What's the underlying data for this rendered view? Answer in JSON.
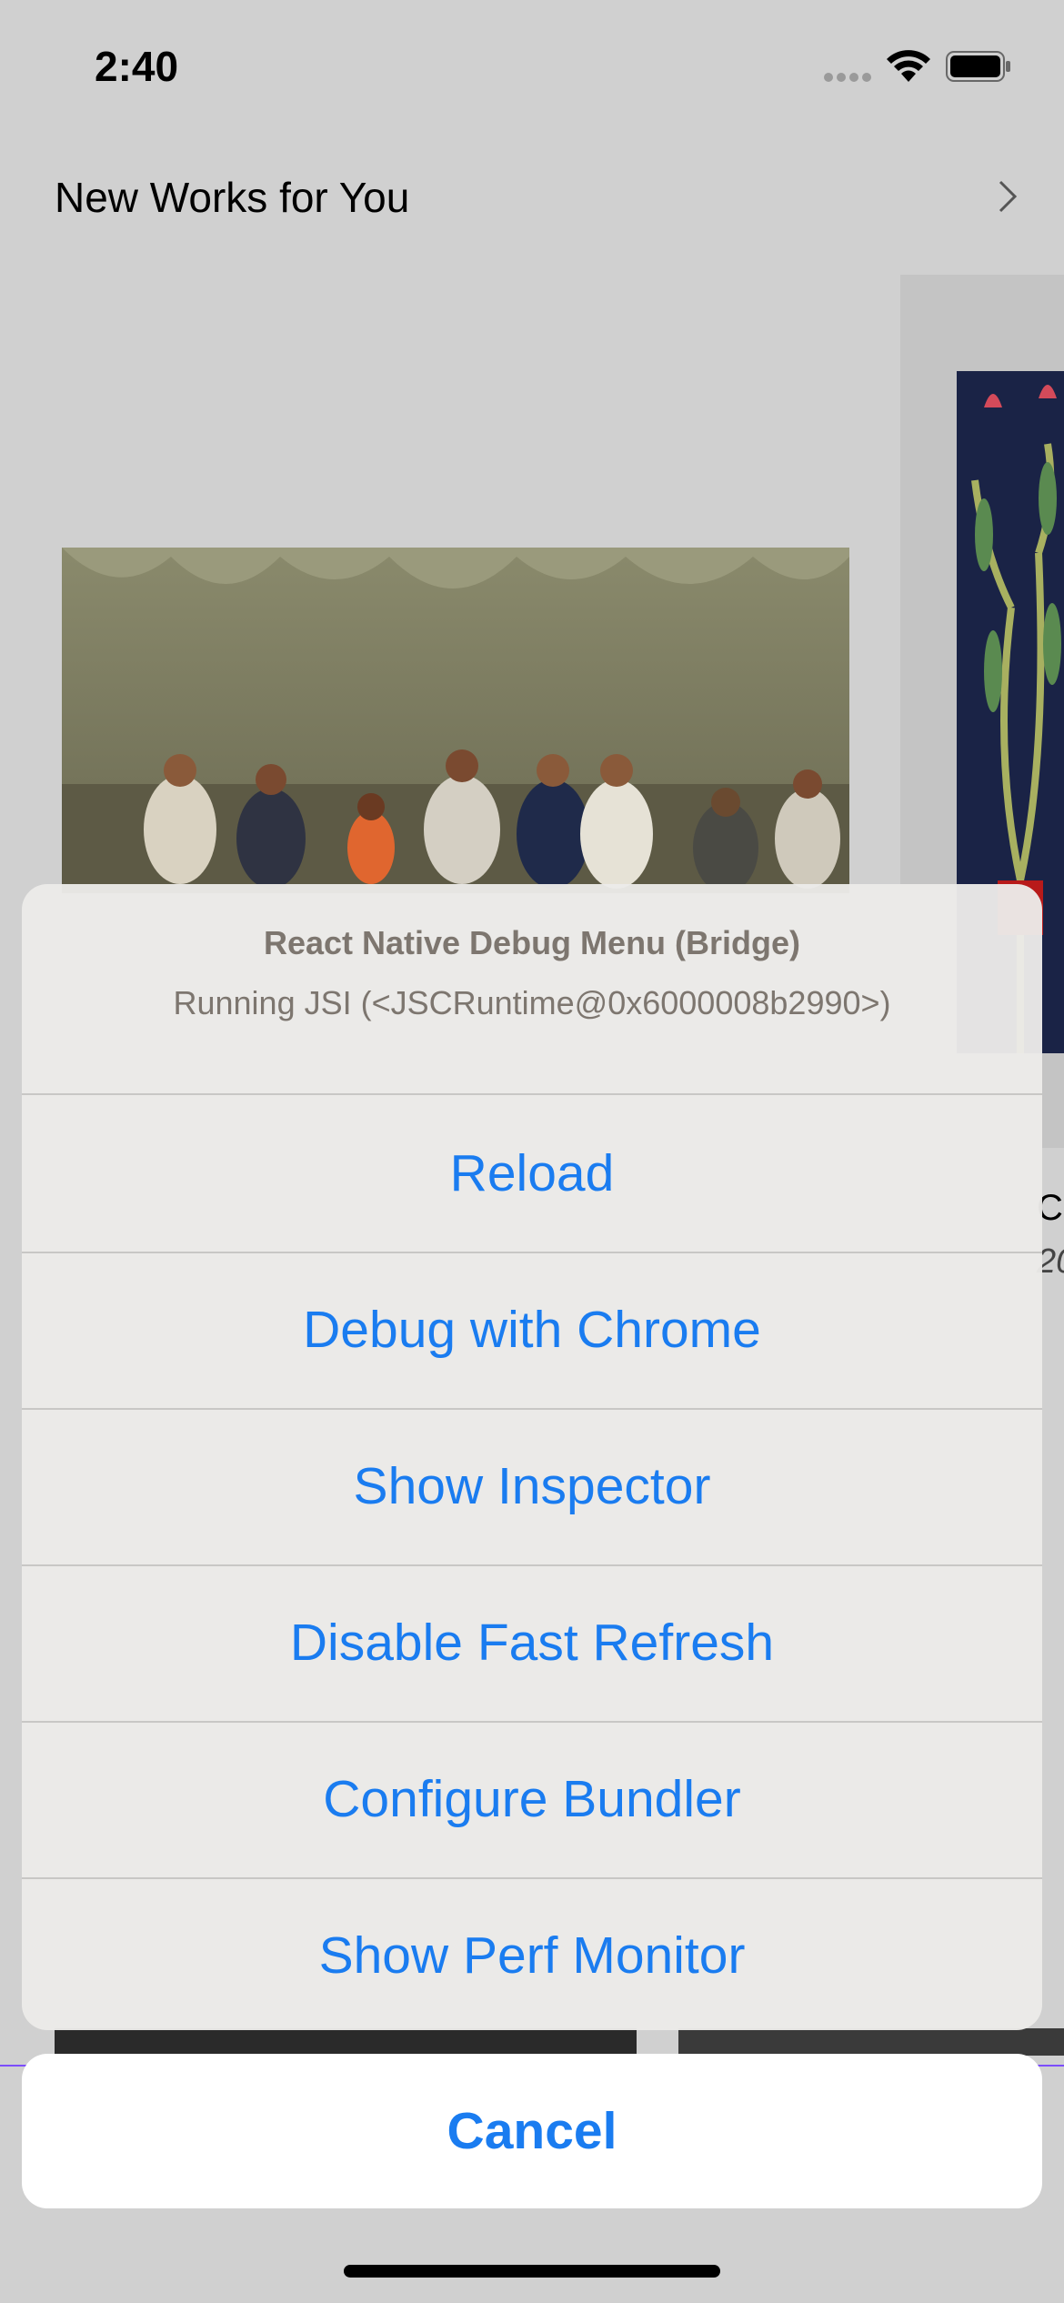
{
  "status_bar": {
    "time": "2:40",
    "icons": [
      "cellular-dots-icon",
      "wifi-icon",
      "battery-icon"
    ]
  },
  "background": {
    "section_title": "New Works for You",
    "right_partial_title": "C",
    "right_partial_subtitle": "20"
  },
  "debug_menu": {
    "title": "React Native Debug Menu (Bridge)",
    "message": "Running JSI (<JSCRuntime@0x6000008b2990>)",
    "actions": [
      {
        "label": "Reload"
      },
      {
        "label": "Debug with Chrome"
      },
      {
        "label": "Show Inspector"
      },
      {
        "label": "Disable Fast Refresh"
      },
      {
        "label": "Configure Bundler"
      },
      {
        "label": "Show Perf Monitor"
      }
    ],
    "cancel_label": "Cancel"
  },
  "colors": {
    "action_blue": "#1a7cf0",
    "header_text": "#7d766f",
    "sheet_bg": "#ecebe9",
    "dim_bg": "#d0d0d0"
  }
}
